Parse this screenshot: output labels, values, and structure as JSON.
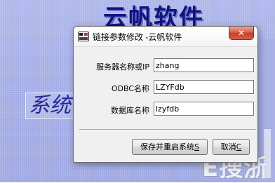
{
  "background": {
    "title": "云帆软件",
    "side_text": "系统",
    "watermark": "E搜浙"
  },
  "dialog": {
    "title": "链接参数修改  -云帆软件",
    "icon": "app-icon",
    "close_glyph": "✕",
    "fields": [
      {
        "label": "服务器名称或IP",
        "value": "zhang"
      },
      {
        "label": "ODBC名称",
        "value": "LZYFdb"
      },
      {
        "label": "数据库名称",
        "value": "lzyfdb"
      }
    ],
    "buttons": {
      "save_restart": {
        "label": "保存并重启系统",
        "accel": "S"
      },
      "cancel": {
        "label": "取消",
        "accel": "C"
      }
    }
  },
  "colors": {
    "desktop": "#a3ade6",
    "bg_title": "#11147a",
    "close_button": "#c7402c",
    "dialog_face": "#f0f0f0"
  }
}
